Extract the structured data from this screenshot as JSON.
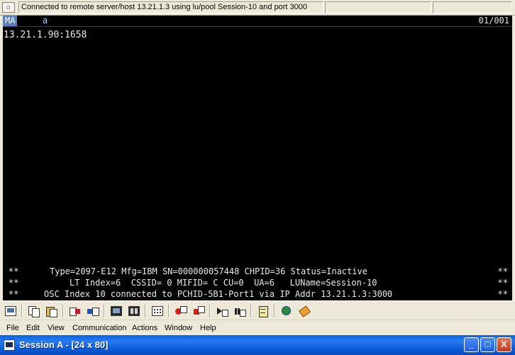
{
  "window": {
    "title": "Session A - [24 x 80]",
    "controls": {
      "minimize": "_",
      "maximize": "□",
      "close": "X"
    }
  },
  "status_bar": {
    "message": "Connected to remote server/host 13.21.1.3 using lu/pool Session-10 and port 3000"
  },
  "terminal": {
    "oia": {
      "mode": "MA",
      "indicator": "a",
      "cursor_position": "01/001"
    },
    "line1": "13.21.1.90:1658",
    "rows": [
      {
        "left": "**",
        "text": "Type=2097-E12 Mfg=IBM SN=000000057448 CHPID=36 Status=Inactive",
        "right": "**"
      },
      {
        "left": "**",
        "text": "LT Index=6  CSSID= 0 MIFID= C CU=0  UA=6   LUName=Session-10",
        "right": "**"
      },
      {
        "left": "**",
        "text": "OSC Index 10 connected to PCHID-5B1-Port1 via IP Addr 13.21.1.3:3000",
        "right": "**"
      }
    ]
  },
  "toolbar": {
    "buttons": [
      {
        "name": "print-screen-icon"
      },
      {
        "name": "copy-icon"
      },
      {
        "name": "paste-icon"
      },
      {
        "name": "send-file-icon"
      },
      {
        "name": "receive-file-icon"
      },
      {
        "name": "display-icon"
      },
      {
        "name": "color-map-icon"
      },
      {
        "name": "keyboard-map-icon"
      },
      {
        "name": "record-macro-icon"
      },
      {
        "name": "stop-macro-icon"
      },
      {
        "name": "play-macro-icon"
      },
      {
        "name": "pause-macro-icon"
      },
      {
        "name": "clipboard-icon"
      },
      {
        "name": "web-icon"
      },
      {
        "name": "help-tag-icon"
      }
    ]
  },
  "menu": {
    "items": [
      "File",
      "Edit",
      "View",
      "Communication",
      "Actions",
      "Window",
      "Help"
    ]
  }
}
